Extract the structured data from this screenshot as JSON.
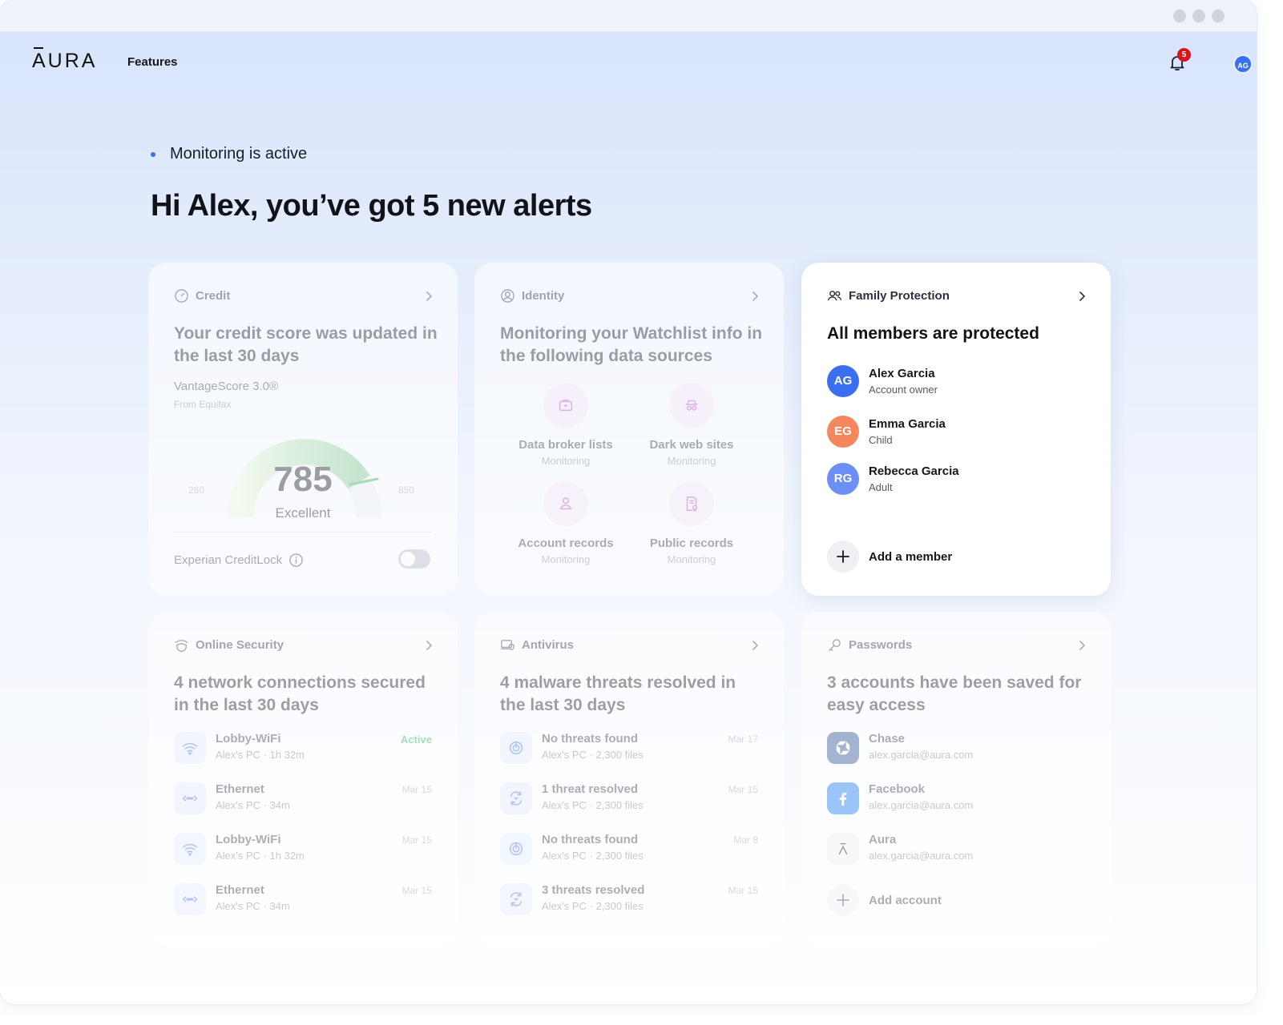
{
  "app": {
    "logo": "AURA",
    "nav_features": "Features",
    "notifications_count": "5",
    "user_initials": "AG"
  },
  "status": {
    "text": "Monitoring is active"
  },
  "greeting": "Hi Alex, you’ve got 5 new alerts",
  "credit": {
    "label": "Credit",
    "title": "Your credit score was updated in the last 30 days",
    "model": "VantageScore 3.0®",
    "source": "From Equifax",
    "score": "785",
    "rating": "Excellent",
    "min": "280",
    "max": "850",
    "lock_label": "Experian CreditLock",
    "lock_on": false
  },
  "identity": {
    "label": "Identity",
    "title": "Monitoring your Watchlist info in the following data sources",
    "sources": [
      {
        "name": "Data broker lists",
        "status": "Monitoring",
        "icon": "briefcase-icon"
      },
      {
        "name": "Dark web sites",
        "status": "Monitoring",
        "icon": "spy-icon"
      },
      {
        "name": "Account records",
        "status": "Monitoring",
        "icon": "person-icon"
      },
      {
        "name": "Public records",
        "status": "Monitoring",
        "icon": "document-icon"
      }
    ]
  },
  "family": {
    "label": "Family Protection",
    "title": "All members are protected",
    "members": [
      {
        "initials": "AG",
        "name": "Alex Garcia",
        "role": "Account owner",
        "color": "#3a6ff0"
      },
      {
        "initials": "EG",
        "name": "Emma Garcia",
        "role": "Child",
        "color": "#f5875f"
      },
      {
        "initials": "RG",
        "name": "Rebecca Garcia",
        "role": "Adult",
        "color": "#6b8ff5"
      }
    ],
    "add_label": "Add a member"
  },
  "online_security": {
    "label": "Online Security",
    "title": "4 network connections secured in the last 30 days",
    "rows": [
      {
        "name": "Lobby-WiFi",
        "device": "Alex's PC",
        "duration": "1h 32m",
        "meta": "Active",
        "icon": "wifi-icon"
      },
      {
        "name": "Ethernet",
        "device": "Alex's PC",
        "duration": "34m",
        "meta": "Mar 15",
        "icon": "ethernet-icon"
      },
      {
        "name": "Lobby-WiFi",
        "device": "Alex's PC",
        "duration": "1h 32m",
        "meta": "Mar 15",
        "icon": "wifi-icon"
      },
      {
        "name": "Ethernet",
        "device": "Alex's PC",
        "duration": "34m",
        "meta": "Mar 15",
        "icon": "ethernet-icon"
      }
    ]
  },
  "antivirus": {
    "label": "Antivirus",
    "title": "4 malware threats resolved in the last 30 days",
    "rows": [
      {
        "name": "No threats found",
        "device": "Alex's PC",
        "files": "2,300 files",
        "date": "Mar 17",
        "icon": "scan-icon"
      },
      {
        "name": "1 threat resolved",
        "device": "Alex's PC",
        "files": "2,300 files",
        "date": "Mar 15",
        "icon": "bug-icon"
      },
      {
        "name": "No threats found",
        "device": "Alex's PC",
        "files": "2,300 files",
        "date": "Mar 8",
        "icon": "scan-icon"
      },
      {
        "name": "3 threats resolved",
        "device": "Alex's PC",
        "files": "2,300 files",
        "date": "Mar 15",
        "icon": "bug-icon"
      }
    ]
  },
  "passwords": {
    "label": "Passwords",
    "title": "3 accounts have been saved for easy access",
    "rows": [
      {
        "name": "Chase",
        "email": "alex.garcia@aura.com",
        "icon": "chase-logo-icon"
      },
      {
        "name": "Facebook",
        "email": "alex.garcia@aura.com",
        "icon": "facebook-logo-icon"
      },
      {
        "name": "Aura",
        "email": "alex.garcia@aura.com",
        "icon": "aura-logo-icon"
      }
    ],
    "add_label": "Add account"
  },
  "colors": {
    "accent": "#3a6ff0",
    "active_green": "#2eb35a",
    "badge_red": "#d8161d",
    "source_pink": "#f5e6f5"
  }
}
